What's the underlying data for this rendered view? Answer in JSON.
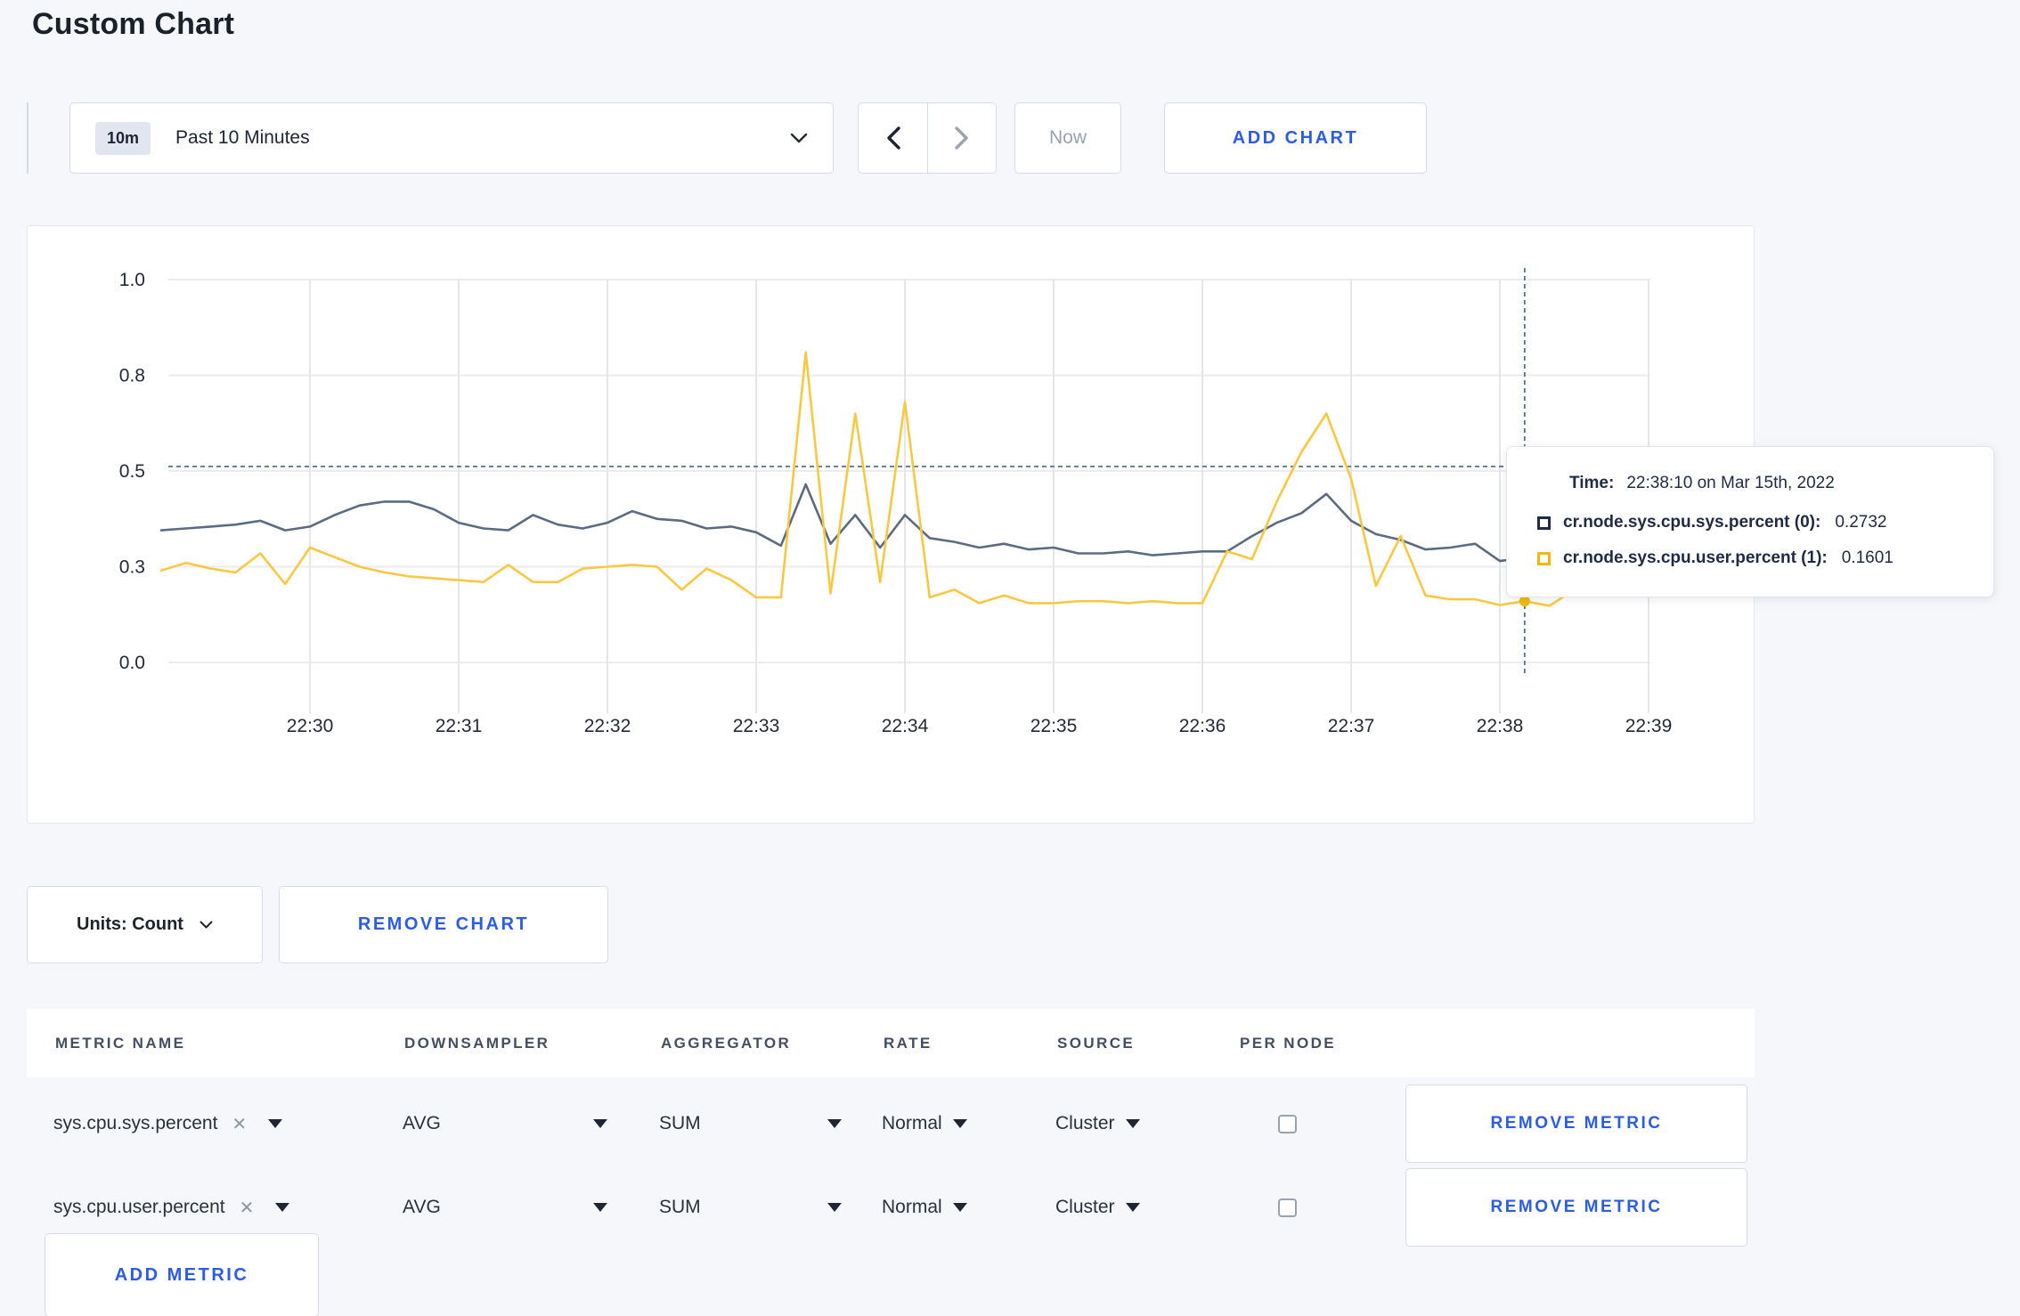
{
  "page": {
    "title": "Custom Chart"
  },
  "toolbar": {
    "time_window_badge": "10m",
    "time_window_label": "Past 10 Minutes",
    "now_label": "Now",
    "add_chart_label": "ADD CHART"
  },
  "chart_data": {
    "type": "line",
    "x_ticks": [
      "22:30",
      "22:31",
      "22:32",
      "22:33",
      "22:34",
      "22:35",
      "22:36",
      "22:37",
      "22:38",
      "22:39"
    ],
    "x_start": "22:29:00",
    "x_end": "22:39:00",
    "interval_seconds": 10,
    "y_range": [
      0,
      1
    ],
    "y_ticks": [
      {
        "label": "0.0",
        "value": 0
      },
      {
        "label": "0.3",
        "value": 0.25
      },
      {
        "label": "0.5",
        "value": 0.5
      },
      {
        "label": "0.8",
        "value": 0.75
      },
      {
        "label": "1.0",
        "value": 1
      }
    ],
    "grid": true,
    "legend_position": "tooltip",
    "series": [
      {
        "name": "cr.node.sys.cpu.sys.percent",
        "color": "#5b6b82",
        "dot_color": "#47536a",
        "values": [
          0.345,
          0.35,
          0.355,
          0.36,
          0.37,
          0.345,
          0.355,
          0.385,
          0.41,
          0.42,
          0.42,
          0.4,
          0.365,
          0.35,
          0.345,
          0.385,
          0.36,
          0.35,
          0.365,
          0.395,
          0.375,
          0.37,
          0.35,
          0.355,
          0.34,
          0.305,
          0.465,
          0.31,
          0.385,
          0.3,
          0.385,
          0.325,
          0.315,
          0.3,
          0.31,
          0.295,
          0.3,
          0.285,
          0.285,
          0.29,
          0.28,
          0.285,
          0.29,
          0.29,
          0.33,
          0.365,
          0.39,
          0.44,
          0.37,
          0.335,
          0.32,
          0.295,
          0.3,
          0.31,
          0.265,
          0.2732,
          0.26,
          0.275,
          0.3,
          0.27,
          0.285
        ]
      },
      {
        "name": "cr.node.sys.cpu.user.percent",
        "color": "#f8c842",
        "dot_color": "#f2b70a",
        "values": [
          0.24,
          0.26,
          0.245,
          0.235,
          0.285,
          0.205,
          0.3,
          0.275,
          0.25,
          0.235,
          0.225,
          0.22,
          0.215,
          0.21,
          0.255,
          0.21,
          0.21,
          0.245,
          0.25,
          0.255,
          0.25,
          0.19,
          0.245,
          0.215,
          0.17,
          0.17,
          0.81,
          0.18,
          0.65,
          0.21,
          0.68,
          0.17,
          0.19,
          0.155,
          0.175,
          0.155,
          0.155,
          0.16,
          0.16,
          0.155,
          0.16,
          0.155,
          0.155,
          0.29,
          0.27,
          0.42,
          0.55,
          0.65,
          0.48,
          0.2,
          0.33,
          0.175,
          0.165,
          0.165,
          0.15,
          0.1601,
          0.148,
          0.19,
          0.31,
          0.21,
          0.27
        ]
      }
    ],
    "crosshair": {
      "index": 55,
      "time": "22:38:10",
      "h_value": 0.512
    }
  },
  "tooltip": {
    "time_label": "Time:",
    "time_value": "22:38:10 on Mar 15th, 2022",
    "rows": [
      {
        "name": "cr.node.sys.cpu.sys.percent (0):",
        "value": "0.2732",
        "color": "#1f2a4d"
      },
      {
        "name": "cr.node.sys.cpu.user.percent (1):",
        "value": "0.1601",
        "color": "#f2b70a"
      }
    ]
  },
  "chart_footer": {
    "units_label": "Units: Count",
    "remove_chart_label": "REMOVE CHART"
  },
  "metrics_table": {
    "headers": [
      "METRIC NAME",
      "DOWNSAMPLER",
      "AGGREGATOR",
      "RATE",
      "SOURCE",
      "PER NODE"
    ],
    "rows": [
      {
        "metric_name": "sys.cpu.sys.percent",
        "downsampler": "AVG",
        "aggregator": "SUM",
        "rate": "Normal",
        "source": "Cluster",
        "per_node_checked": false,
        "remove_label": "REMOVE METRIC"
      },
      {
        "metric_name": "sys.cpu.user.percent",
        "downsampler": "AVG",
        "aggregator": "SUM",
        "rate": "Normal",
        "source": "Cluster",
        "per_node_checked": false,
        "remove_label": "REMOVE METRIC"
      }
    ],
    "add_metric_label": "ADD METRIC"
  },
  "icons": {
    "close": "✕"
  },
  "colors": {
    "accent_blue": "#2a5ce6",
    "page_bg": "#f5f7fa",
    "grid_line": "#ececee",
    "crosshair": "#54708c",
    "series_sys": "#5b6b82",
    "series_user": "#f8c842"
  }
}
